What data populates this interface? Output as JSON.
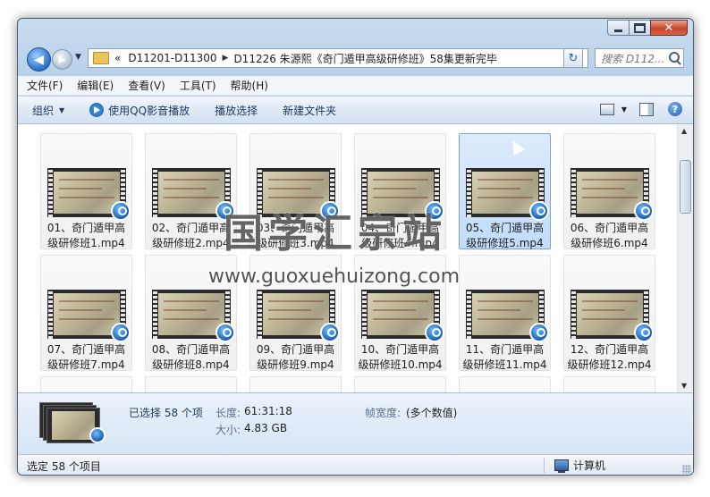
{
  "navbar": {
    "path_overflow": "«",
    "path_segments": [
      "D11201-D11300",
      "D11226 朱源熙《奇门遁甲高级研修班》58集更新完毕"
    ],
    "search_placeholder": "搜索 D112..."
  },
  "menu": [
    "文件(F)",
    "编辑(E)",
    "查看(V)",
    "工具(T)",
    "帮助(H)"
  ],
  "commands": {
    "organize": "组织",
    "play_qq": "使用QQ影音播放",
    "play_selection": "播放选择",
    "new_folder": "新建文件夹"
  },
  "files": [
    {
      "line1": "01、奇门遁甲高",
      "line2": "级研修班1.mp4",
      "selected": false
    },
    {
      "line1": "02、奇门遁甲高",
      "line2": "级研修班2.mp4",
      "selected": false
    },
    {
      "line1": "03、奇门遁甲高",
      "line2": "级研修班3.mp4",
      "selected": false
    },
    {
      "line1": "04、奇门遁甲高",
      "line2": "级研修班4.mp4",
      "selected": false
    },
    {
      "line1": "05、奇门遁甲高",
      "line2": "级研修班5.mp4",
      "selected": true
    },
    {
      "line1": "06、奇门遁甲高",
      "line2": "级研修班6.mp4",
      "selected": false
    },
    {
      "line1": "07、奇门遁甲高",
      "line2": "级研修班7.mp4",
      "selected": false
    },
    {
      "line1": "08、奇门遁甲高",
      "line2": "级研修班8.mp4",
      "selected": false
    },
    {
      "line1": "09、奇门遁甲高",
      "line2": "级研修班9.mp4",
      "selected": false
    },
    {
      "line1": "10、奇门遁甲高",
      "line2": "级研修班10.mp4",
      "selected": false
    },
    {
      "line1": "11、奇门遁甲高",
      "line2": "级研修班11.mp4",
      "selected": false
    },
    {
      "line1": "12、奇门遁甲高",
      "line2": "级研修班12.mp4",
      "selected": false
    }
  ],
  "watermark": {
    "chinese": "国学汇宗站",
    "url": "www.guoxuehuizong.com"
  },
  "details": {
    "selected_text": "已选择 58 个项",
    "length_label": "长度:",
    "length_value": "61:31:18",
    "size_label": "大小:",
    "size_value": "4.83 GB",
    "framewidth_label": "帧宽度:",
    "framewidth_value": "(多个数值)"
  },
  "status": {
    "left": "选定 58 个项目",
    "right": "计算机"
  },
  "colors": {
    "window_frame": "#b9d1ea",
    "selection": "#c1dcfc",
    "close_button": "#c6452a"
  }
}
